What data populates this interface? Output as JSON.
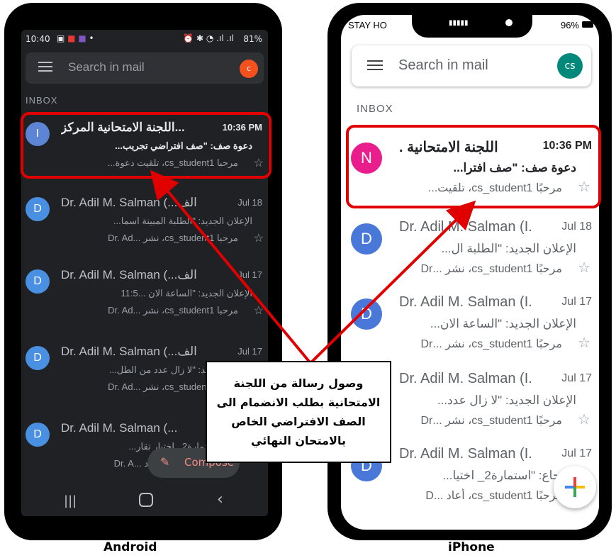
{
  "android": {
    "status_time": "10:40",
    "status_right": "81%",
    "search_placeholder": "Search in mail",
    "avatar_letter": "c",
    "inbox_label": "INBOX",
    "emails": [
      {
        "avatar": "I",
        "avatar_color": "#5c85d6",
        "sender": "اللجنة الامتحانية المركز...",
        "date": "10:36 PM",
        "subject": "دعوة صف: \"صف افتراضي تجريب...",
        "snippet": "مرحبا cs_student1، تلقيت دعوة...",
        "unread": true
      },
      {
        "avatar": "D",
        "avatar_color": "#4a90e2",
        "sender": "Dr. Adil M. Salman (...الف",
        "date": "Jul 18",
        "subject": "الإعلان الجديد: \"الطلبة المبينة اسما...",
        "snippet": "مرحبا cs_student1، نشر ...Dr. Ad",
        "unread": false
      },
      {
        "avatar": "D",
        "avatar_color": "#4a90e2",
        "sender": "Dr. Adil M. Salman (...الف",
        "date": "Jul 17",
        "subject": "الإعلان الجديد: \"الساعة الان ...11:5",
        "snippet": "مرحبا cs_student1، نشر ...Dr. Ad",
        "unread": false
      },
      {
        "avatar": "D",
        "avatar_color": "#4a90e2",
        "sender": "Dr. Adil M. Salman (...الف",
        "date": "Jul 17",
        "subject": "الإعلان الجديد: \"لا زال عدد من الطل...",
        "snippet": "مرحبا cs_student1، نشر ...Dr. Ad",
        "unread": false
      },
      {
        "avatar": "D",
        "avatar_color": "#4a90e2",
        "sender": "Dr. Adil M. Salman (...",
        "date": "",
        "subject": "الإرجاع: \"استمارة2_ اختيار تقار...",
        "snippet": "مرحبا cs_student1، أعاد ...Dr. A",
        "unread": false
      }
    ],
    "compose_label": "Compose"
  },
  "iphone": {
    "status_left": "STAY HO",
    "status_right": "96%",
    "search_placeholder": "Search in mail",
    "avatar_letters": "cs",
    "inbox_label": "INBOX",
    "emails": [
      {
        "avatar": "N",
        "avatar_color": "#e91e8c",
        "sender": ". اللجنة الامتحانية",
        "date": "10:36 PM",
        "subject": "دعوة صف: \"صف افترا...",
        "snippet": "مرحبًا cs_student1، تلقيت...",
        "unread": true
      },
      {
        "avatar": "D",
        "avatar_color": "#4a78d8",
        "sender": "Dr. Adil M. Salman (I.",
        "date": "Jul 18",
        "subject": "الإعلان الجديد: \"الطلبة ال...",
        "snippet": "مرحبًا cs_student1، نشر ...Dr",
        "unread": false
      },
      {
        "avatar": "D",
        "avatar_color": "#4a78d8",
        "sender": "Dr. Adil M. Salman (I.",
        "date": "Jul 17",
        "subject": "الإعلان الجديد: \"الساعة الان...",
        "snippet": "مرحبًا cs_student1، نشر ...Dr",
        "unread": false
      },
      {
        "avatar": "D",
        "avatar_color": "#4a78d8",
        "sender": "Dr. Adil M. Salman (I.",
        "date": "Jul 17",
        "subject": "الإعلان الجديد: \"لا زال عدد...",
        "snippet": "مرحبًا cs_student1، نشر ...Dr",
        "unread": false
      },
      {
        "avatar": "D",
        "avatar_color": "#4a78d8",
        "sender": "Dr. Adil M. Salman (I.",
        "date": "Jul 17",
        "subject": "الإرجاع: \"استمارة2_ اختيا...",
        "snippet": "مرحبًا cs_student1، أعاد ...D",
        "unread": false
      }
    ]
  },
  "callout_text": "وصول رسالة من اللجنة الامتحانية بطلب الانضمام الى الصف الافتراضي الخاص بالامتحان النهائي",
  "captions": {
    "android": "Android",
    "iphone": "iPhone"
  },
  "colors": {
    "highlight": "#e00000",
    "android_bg": "#202124"
  }
}
